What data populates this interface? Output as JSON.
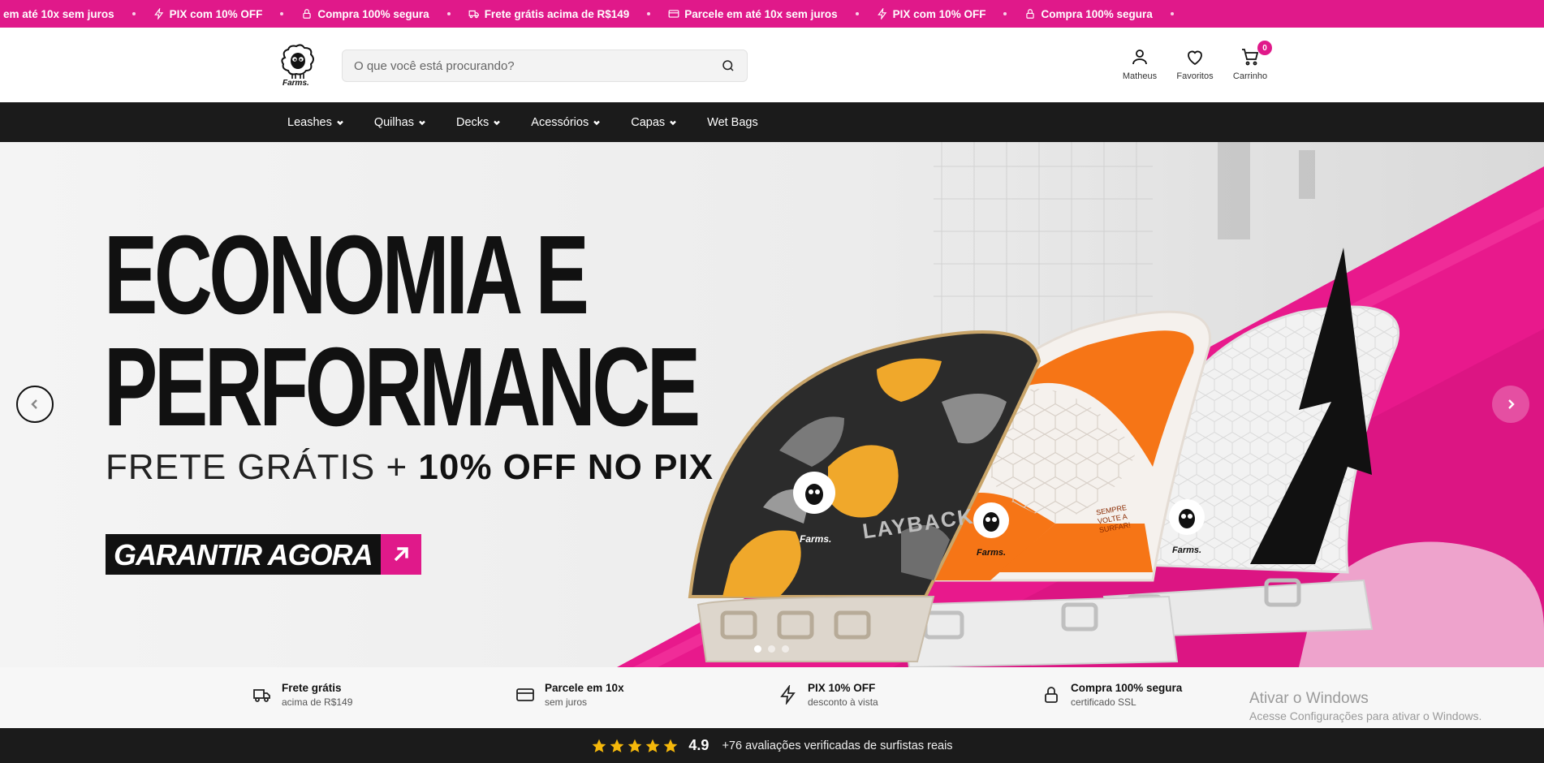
{
  "promo_bar": {
    "items": [
      {
        "icon": "card-icon",
        "label": "em até 10x sem juros"
      },
      {
        "icon": "lightning-icon",
        "label": "PIX com 10% OFF"
      },
      {
        "icon": "lock-icon",
        "label": "Compra 100% segura"
      },
      {
        "icon": "truck-icon",
        "label": "Frete grátis acima de R$149"
      },
      {
        "icon": "card-icon",
        "label": "Parcele em até 10x sem juros"
      },
      {
        "icon": "lightning-icon",
        "label": "PIX com 10% OFF"
      },
      {
        "icon": "lock-icon",
        "label": "Compra 100% segura"
      }
    ],
    "background": "#e0198a"
  },
  "header": {
    "logo_text": "Farms.",
    "search": {
      "placeholder": "O que você está procurando?"
    },
    "account_label": "Matheus",
    "favorites_label": "Favoritos",
    "cart_label": "Carrinho",
    "cart_count": "0"
  },
  "nav": {
    "items": [
      {
        "label": "Leashes",
        "has_dropdown": true
      },
      {
        "label": "Quilhas",
        "has_dropdown": true
      },
      {
        "label": "Decks",
        "has_dropdown": true
      },
      {
        "label": "Acessórios",
        "has_dropdown": true
      },
      {
        "label": "Capas",
        "has_dropdown": true
      },
      {
        "label": "Wet Bags",
        "has_dropdown": false
      }
    ]
  },
  "hero": {
    "title_line1": "ECONOMIA E",
    "title_line2": "PERFORMANCE",
    "subtitle_a": "FRETE GRÁTIS + ",
    "subtitle_b": "10% OFF NO PIX",
    "cta_label": "GARANTIR AGORA",
    "fin1_text": "LAYBACK",
    "fin2_text": "SEMPRE VOLTE A SURFAR!",
    "fin_brand": "Farms.",
    "slides_total": 3,
    "active_slide": 1
  },
  "benefits": [
    {
      "icon": "truck-icon",
      "title": "Frete grátis",
      "subtitle": "acima de R$149"
    },
    {
      "icon": "card-icon",
      "title": "Parcele em 10x",
      "subtitle": "sem juros"
    },
    {
      "icon": "lightning-icon",
      "title": "PIX 10% OFF",
      "subtitle": "desconto à vista"
    },
    {
      "icon": "lock-icon",
      "title": "Compra 100% segura",
      "subtitle": "certificado SSL"
    }
  ],
  "windows_watermark": {
    "title": "Ativar o Windows",
    "subtitle": "Acesse Configurações para ativar o Windows."
  },
  "reviews": {
    "stars": 5,
    "rating": "4.9",
    "text": "+76 avaliações verificadas de surfistas reais"
  },
  "colors": {
    "accent": "#e0198a",
    "dark": "#1b1b1b",
    "star": "#f5b80b"
  }
}
